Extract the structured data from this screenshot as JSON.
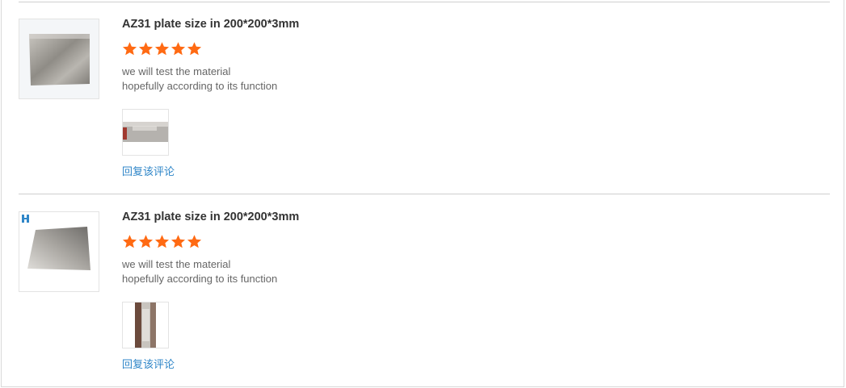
{
  "reviews": [
    {
      "product_title": "AZ31 plate size in 200*200*3mm",
      "rating": 5,
      "comment_lines": [
        "we will test the material",
        "hopefully according to its function"
      ],
      "reply_label": "回复该评论"
    },
    {
      "product_title": "AZ31 plate size in 200*200*3mm",
      "rating": 5,
      "comment_lines": [
        "we will test the material",
        "hopefully according to its function"
      ],
      "reply_label": "回复该评论"
    }
  ],
  "colors": {
    "star": "#ff6a13",
    "link": "#2f86c8",
    "title": "#333333",
    "comment": "#666666"
  },
  "icons": {
    "star": "star-icon",
    "badge": "brand-badge-icon"
  }
}
